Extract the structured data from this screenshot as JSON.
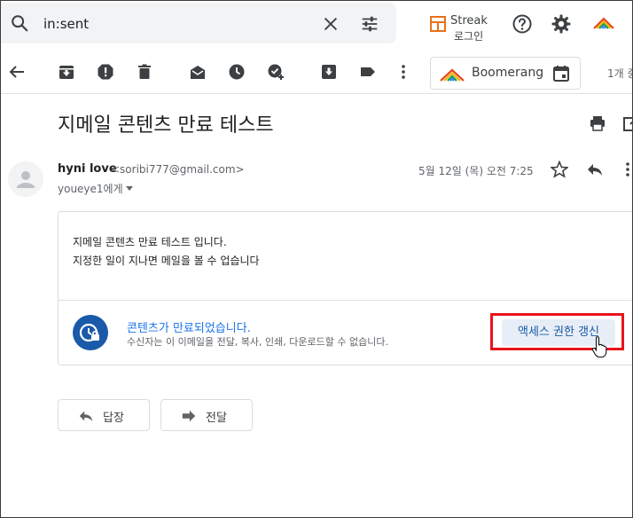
{
  "search": {
    "value": "in:sent"
  },
  "streak": {
    "name": "Streak",
    "login": "로그인"
  },
  "boomerang": {
    "label": "Boomerang"
  },
  "toolbar": {
    "count": "1개 중"
  },
  "email": {
    "subject": "지메일 콘텐츠 만료 테스트",
    "sender_name": "hyni love",
    "sender_email": "<soribi777@gmail.com>",
    "recipient": "youeye1에게",
    "date": "5월 12일 (목) 오전 7:25",
    "body_lines": [
      "지메일 콘텐츠 만료 테스트 입니다.",
      "지정한 일이 지나면 메일을 볼 수 업습니다"
    ]
  },
  "expired": {
    "title": "콘텐츠가 만료되었습니다.",
    "description": "수신자는 이 이메일을 전달, 복사, 인쇄, 다운로드할 수 없습니다.",
    "renew_label": "액세스 권한 갱신"
  },
  "actions": {
    "reply_label": "답장",
    "forward_label": "전달"
  },
  "colors": {
    "accent": "#1a73e8",
    "highlight": "#e8141b",
    "expire_icon_bg": "#1a5aa8"
  }
}
